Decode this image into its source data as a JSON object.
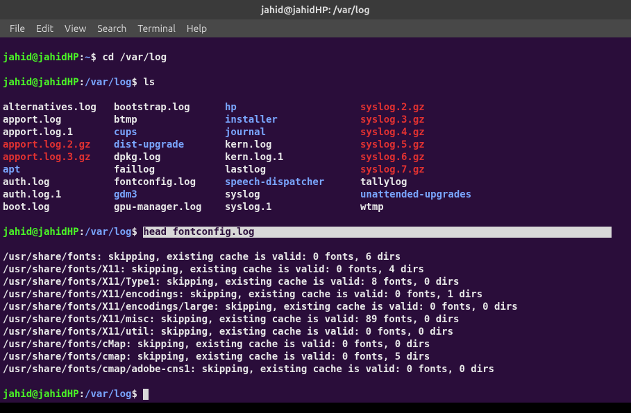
{
  "titlebar": {
    "text": "jahid@jahidHP: /var/log"
  },
  "menu": {
    "file": "File",
    "edit": "Edit",
    "view": "View",
    "search": "Search",
    "terminal": "Terminal",
    "help": "Help"
  },
  "prompt1": {
    "userhost": "jahid@jahidHP",
    "colon": ":",
    "path": "~",
    "dollar": "$ ",
    "cmd": "cd /var/log"
  },
  "prompt2": {
    "userhost": "jahid@jahidHP",
    "colon": ":",
    "path": "/var/log",
    "dollar": "$ ",
    "cmd": "ls"
  },
  "ls": {
    "rows": [
      [
        {
          "text": "alternatives.log",
          "cls": "white"
        },
        {
          "text": "bootstrap.log",
          "cls": "white"
        },
        {
          "text": "hp",
          "cls": "blue"
        },
        {
          "text": "syslog.2.gz",
          "cls": "red"
        }
      ],
      [
        {
          "text": "apport.log",
          "cls": "white"
        },
        {
          "text": "btmp",
          "cls": "white"
        },
        {
          "text": "installer",
          "cls": "blue"
        },
        {
          "text": "syslog.3.gz",
          "cls": "red"
        }
      ],
      [
        {
          "text": "apport.log.1",
          "cls": "white"
        },
        {
          "text": "cups",
          "cls": "blue"
        },
        {
          "text": "journal",
          "cls": "blue"
        },
        {
          "text": "syslog.4.gz",
          "cls": "red"
        }
      ],
      [
        {
          "text": "apport.log.2.gz",
          "cls": "red"
        },
        {
          "text": "dist-upgrade",
          "cls": "blue"
        },
        {
          "text": "kern.log",
          "cls": "white"
        },
        {
          "text": "syslog.5.gz",
          "cls": "red"
        }
      ],
      [
        {
          "text": "apport.log.3.gz",
          "cls": "red"
        },
        {
          "text": "dpkg.log",
          "cls": "white"
        },
        {
          "text": "kern.log.1",
          "cls": "white"
        },
        {
          "text": "syslog.6.gz",
          "cls": "red"
        }
      ],
      [
        {
          "text": "apt",
          "cls": "blue"
        },
        {
          "text": "faillog",
          "cls": "white"
        },
        {
          "text": "lastlog",
          "cls": "white"
        },
        {
          "text": "syslog.7.gz",
          "cls": "red"
        }
      ],
      [
        {
          "text": "auth.log",
          "cls": "white"
        },
        {
          "text": "fontconfig.log",
          "cls": "white"
        },
        {
          "text": "speech-dispatcher",
          "cls": "blue"
        },
        {
          "text": "tallylog",
          "cls": "white"
        }
      ],
      [
        {
          "text": "auth.log.1",
          "cls": "white"
        },
        {
          "text": "gdm3",
          "cls": "blue"
        },
        {
          "text": "syslog",
          "cls": "white"
        },
        {
          "text": "unattended-upgrades",
          "cls": "blue"
        }
      ],
      [
        {
          "text": "boot.log",
          "cls": "white"
        },
        {
          "text": "gpu-manager.log",
          "cls": "white"
        },
        {
          "text": "syslog.1",
          "cls": "white"
        },
        {
          "text": "wtmp",
          "cls": "white"
        }
      ]
    ]
  },
  "prompt3": {
    "userhost": "jahid@jahidHP",
    "colon": ":",
    "path": "/var/log",
    "dollar": "$ ",
    "cmd_hl": "head fontconfig.log"
  },
  "output": {
    "lines": [
      "/usr/share/fonts: skipping, existing cache is valid: 0 fonts, 6 dirs",
      "/usr/share/fonts/X11: skipping, existing cache is valid: 0 fonts, 4 dirs",
      "/usr/share/fonts/X11/Type1: skipping, existing cache is valid: 8 fonts, 0 dirs",
      "/usr/share/fonts/X11/encodings: skipping, existing cache is valid: 0 fonts, 1 dirs",
      "/usr/share/fonts/X11/encodings/large: skipping, existing cache is valid: 0 fonts, 0 dirs",
      "/usr/share/fonts/X11/misc: skipping, existing cache is valid: 89 fonts, 0 dirs",
      "/usr/share/fonts/X11/util: skipping, existing cache is valid: 0 fonts, 0 dirs",
      "/usr/share/fonts/cMap: skipping, existing cache is valid: 0 fonts, 0 dirs",
      "/usr/share/fonts/cmap: skipping, existing cache is valid: 0 fonts, 5 dirs",
      "/usr/share/fonts/cmap/adobe-cns1: skipping, existing cache is valid: 0 fonts, 0 dirs"
    ]
  },
  "prompt4": {
    "userhost": "jahid@jahidHP",
    "colon": ":",
    "path": "/var/log",
    "dollar": "$ "
  }
}
